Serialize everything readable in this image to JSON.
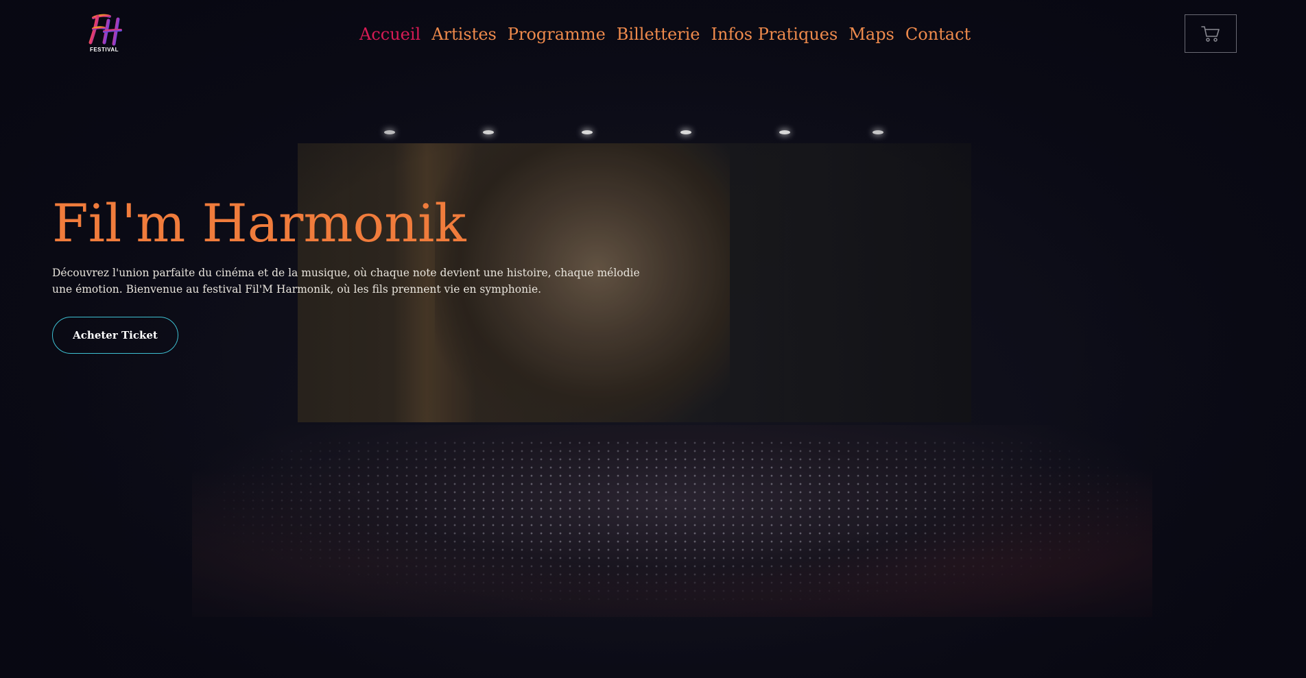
{
  "logo": {
    "text": "FESTIVAL",
    "icon": "fh-festival-logo"
  },
  "nav": {
    "items": [
      {
        "label": "Accueil",
        "active": true
      },
      {
        "label": "Artistes",
        "active": false
      },
      {
        "label": "Programme",
        "active": false
      },
      {
        "label": "Billetterie",
        "active": false
      },
      {
        "label": "Infos Pratiques",
        "active": false
      },
      {
        "label": "Maps",
        "active": false
      },
      {
        "label": "Contact",
        "active": false
      }
    ]
  },
  "cart": {
    "icon": "cart-icon"
  },
  "hero": {
    "title": "Fil'm Harmonik",
    "description": "Découvrez l'union parfaite du cinéma et de la musique, où chaque note devient une histoire, chaque mélodie une émotion. Bienvenue au festival Fil'M Harmonik, où les fils prennent vie en symphonie.",
    "cta_label": "Acheter Ticket"
  },
  "colors": {
    "background": "#0b0b16",
    "nav_text": "#ee8a4c",
    "nav_active": "#d81b55",
    "title": "#f07c3c",
    "cta_border": "#3ec1d3",
    "cart_border": "#6b6b75"
  }
}
